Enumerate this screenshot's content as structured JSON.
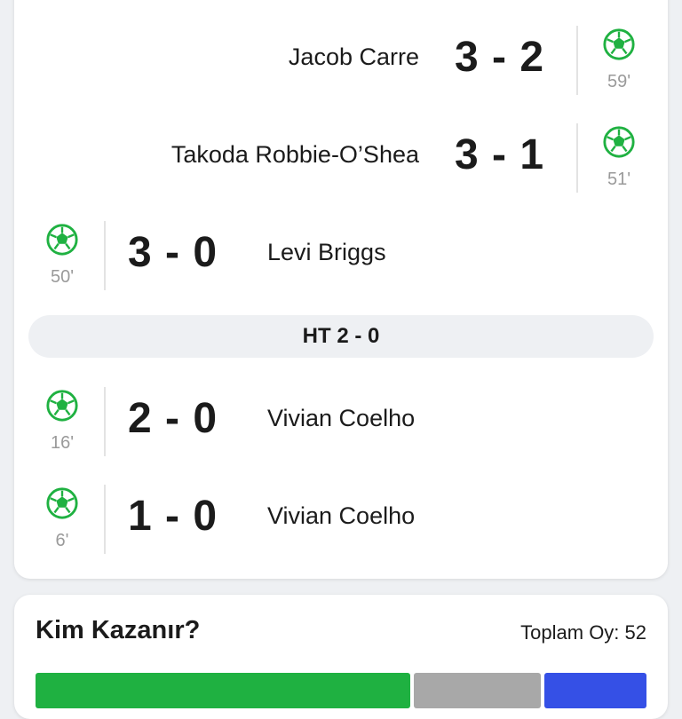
{
  "colors": {
    "goal_icon": "#1fb141",
    "poll_home": "#1fb141",
    "poll_draw": "#a8a8a8",
    "poll_away": "#3550e6"
  },
  "events": [
    {
      "side": "away",
      "score": "3 - 2",
      "player": "Jacob Carre",
      "minute": "59'",
      "icon": "soccer-ball-icon"
    },
    {
      "side": "away",
      "score": "3 - 1",
      "player": "Takoda Robbie-O’Shea",
      "minute": "51'",
      "icon": "soccer-ball-icon"
    },
    {
      "side": "home",
      "score": "3 - 0",
      "player": "Levi Briggs",
      "minute": "50'",
      "icon": "soccer-ball-icon"
    },
    {
      "side": "home",
      "score": "2 - 0",
      "player": "Vivian Coelho",
      "minute": "16'",
      "icon": "soccer-ball-icon"
    },
    {
      "side": "home",
      "score": "1 - 0",
      "player": "Vivian Coelho",
      "minute": "6'",
      "icon": "soccer-ball-icon"
    }
  ],
  "halftime": {
    "label": "HT 2 - 0"
  },
  "poll": {
    "title": "Kim Kazanır?",
    "total": "Toplam Oy: 52"
  }
}
